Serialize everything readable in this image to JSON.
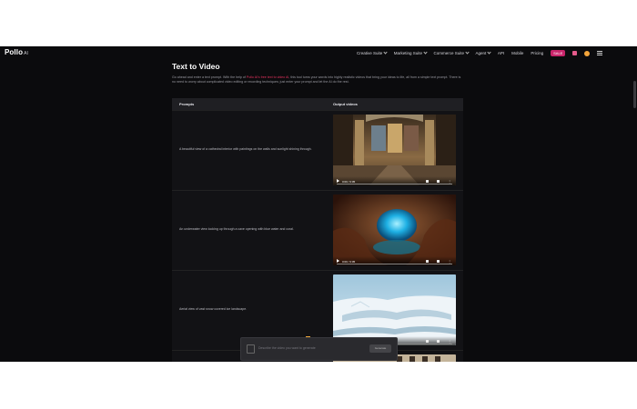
{
  "nav": {
    "logo": "Pollo",
    "logo_suffix": "AI",
    "items": [
      {
        "label": "Creative Suite",
        "dropdown": true
      },
      {
        "label": "Marketing Suite",
        "dropdown": true
      },
      {
        "label": "Commerce Suite",
        "dropdown": true
      },
      {
        "label": "Agent",
        "dropdown": true
      },
      {
        "label": "API",
        "dropdown": false
      },
      {
        "label": "Mobile",
        "dropdown": false
      },
      {
        "label": "Pricing",
        "dropdown": false
      }
    ],
    "sale_badge": "SALE",
    "colors": {
      "sale": "#c9246a",
      "gift": "#e65b8b",
      "avatar": "#f3a53b"
    }
  },
  "page": {
    "title": "Text to Video",
    "intro_before": "Go ahead and enter a text prompt. With the help of",
    "intro_link": "Pollo AI's free text to video AI",
    "intro_after": ", this tool turns your words into highly realistic videos that bring your ideas to life, all from a simple text prompt. There is no need to worry about complicated video editing or recording techniques; just enter your prompt and let the AI do the rest."
  },
  "table": {
    "col_prompts": "Prompts",
    "col_output": "Output videos",
    "rows": [
      {
        "prompt": "A beautiful view of a cathedral interior with paintings on the walls and sunlight shining through.",
        "time": "0:00 / 0:05"
      },
      {
        "prompt": "An underwater view looking up through a cave opening with blue water and coral.",
        "time": "0:00 / 0:05"
      },
      {
        "prompt": "Aerial view of vast snow covered ice landscape.",
        "time": "0:00 / 0:05"
      }
    ]
  },
  "bottom_bar": {
    "placeholder": "Describe the video you want to generate",
    "button": "Generate"
  }
}
